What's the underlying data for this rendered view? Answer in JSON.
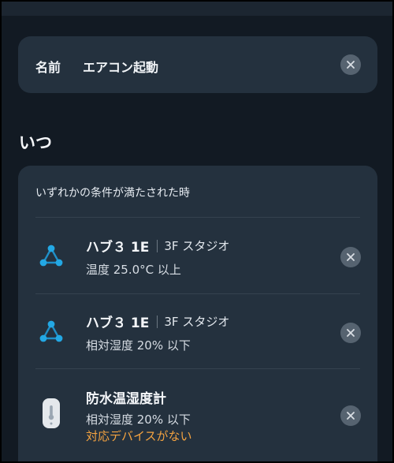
{
  "name_card": {
    "label": "名前",
    "value": "エアコン起動",
    "clear_icon": "close-icon"
  },
  "section_title": "いつ",
  "conditions": {
    "header": "いずれかの条件が満たされた時",
    "items": [
      {
        "icon": "hub-icon",
        "title": "ハブ３ 1E",
        "location": "3F スタジオ",
        "desc": "温度 25.0°C 以上",
        "warning": ""
      },
      {
        "icon": "hub-icon",
        "title": "ハブ３ 1E",
        "location": "3F スタジオ",
        "desc": "相対湿度 20% 以下",
        "warning": ""
      },
      {
        "icon": "thermohygrometer-icon",
        "title": "防水温湿度計",
        "location": "",
        "desc": "相対湿度 20% 以下",
        "warning": "対応デバイスがない"
      }
    ]
  },
  "colors": {
    "background": "#121a23",
    "card": "#24313e",
    "accent_blue": "#23a8e4",
    "warning": "#f4a340"
  }
}
